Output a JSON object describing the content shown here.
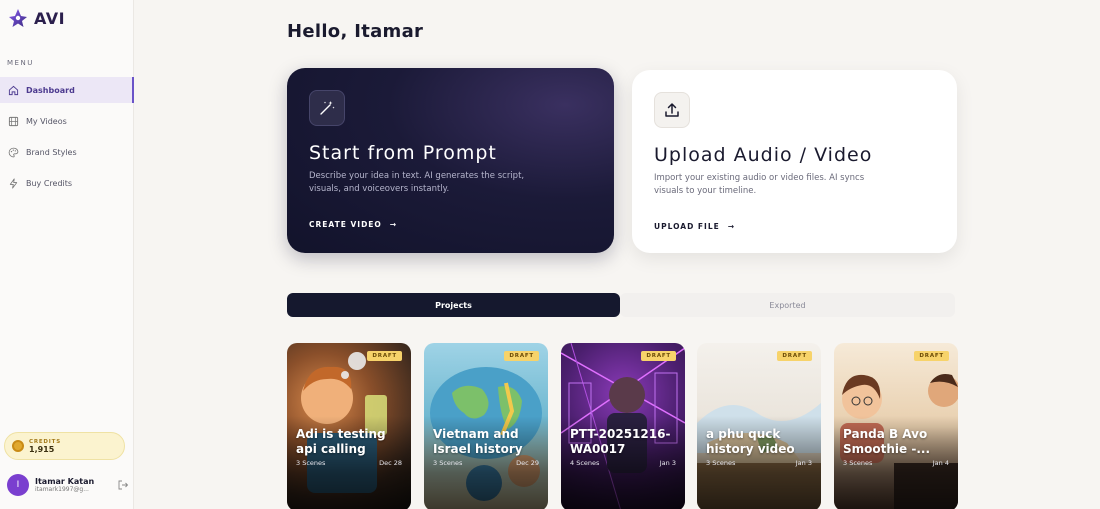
{
  "app": {
    "name": "AVI"
  },
  "sidebar": {
    "menu_label": "MENU",
    "items": [
      {
        "label": "Dashboard",
        "icon": "home-icon",
        "active": true
      },
      {
        "label": "My Videos",
        "icon": "film-icon",
        "active": false
      },
      {
        "label": "Brand Styles",
        "icon": "palette-icon",
        "active": false
      },
      {
        "label": "Buy Credits",
        "icon": "lightning-icon",
        "active": false
      }
    ],
    "credits": {
      "label": "CREDITS",
      "value": "1,915"
    },
    "user": {
      "initial": "I",
      "name": "Itamar Katan",
      "email": "itamark1997@g..."
    }
  },
  "greeting": {
    "prefix": "Hello,",
    "name": "Itamar"
  },
  "cards": {
    "prompt": {
      "title": "Start from Prompt",
      "description": "Describe your idea in text. AI generates the script, visuals, and voiceovers instantly.",
      "cta": "CREATE VIDEO",
      "icon": "magic-wand-icon"
    },
    "upload": {
      "title": "Upload Audio / Video",
      "description": "Import your existing audio or video files. AI syncs visuals to your timeline.",
      "cta": "UPLOAD FILE",
      "icon": "upload-icon"
    }
  },
  "tabs": [
    {
      "label": "Projects",
      "active": true
    },
    {
      "label": "Exported",
      "active": false
    }
  ],
  "projects": [
    {
      "title": "Adi is testing api calling",
      "scenes": "3 Scenes",
      "date": "Dec 28",
      "badge": "DRAFT"
    },
    {
      "title": "Vietnam and Israel history",
      "scenes": "3 Scenes",
      "date": "Dec 29",
      "badge": "DRAFT"
    },
    {
      "title": "PTT-20251216-WA0017",
      "scenes": "4 Scenes",
      "date": "Jan 3",
      "badge": "DRAFT"
    },
    {
      "title": "a phu quck history video",
      "scenes": "3 Scenes",
      "date": "Jan 3",
      "badge": "DRAFT"
    },
    {
      "title": "Panda B Avo Smoothie -...",
      "scenes": "3 Scenes",
      "date": "Jan 4",
      "badge": "DRAFT"
    }
  ],
  "colors": {
    "accent": "#6a53c8",
    "dark_card": "#1b1a38",
    "draft_badge": "#f7d36a"
  }
}
